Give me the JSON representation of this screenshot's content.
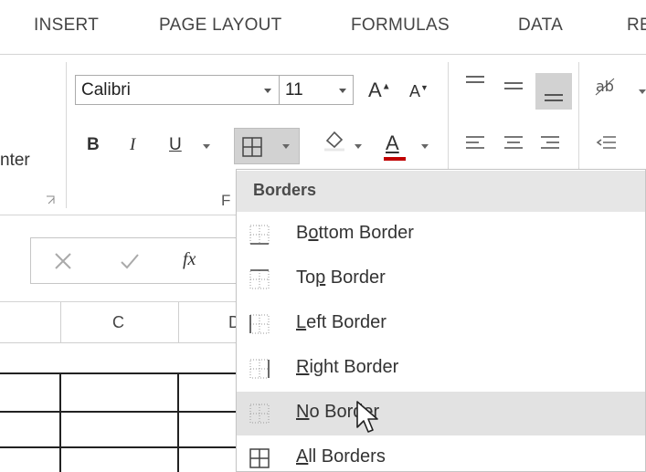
{
  "tabs": [
    "INSERT",
    "PAGE LAYOUT",
    "FORMULAS",
    "DATA",
    "RE"
  ],
  "font": {
    "name": "Calibri",
    "size": "11"
  },
  "ribbon": {
    "bold": "B",
    "italic": "I",
    "underline": "U",
    "grow_font": "A",
    "shrink_font": "A",
    "font_color": "A",
    "left_cut_label": "nter",
    "group_label_cut": "F"
  },
  "formula_bar": {
    "fx": "fx"
  },
  "columns": {
    "c": "C",
    "d_cut": "D"
  },
  "menu": {
    "header": "Borders",
    "items": [
      {
        "pre": "B",
        "u": "o",
        "post": "ttom Border"
      },
      {
        "pre": "To",
        "u": "p",
        "post": " Border"
      },
      {
        "pre": "",
        "u": "L",
        "post": "eft Border"
      },
      {
        "pre": "",
        "u": "R",
        "post": "ight Border"
      },
      {
        "pre": "",
        "u": "N",
        "post": "o Border"
      },
      {
        "pre": "",
        "u": "A",
        "post": "ll Borders"
      }
    ],
    "hover_index": 4
  },
  "colors": {
    "hover": "#e2e2e2",
    "header_bg": "#e6e6e6",
    "font_color_bar": "#c00000"
  }
}
